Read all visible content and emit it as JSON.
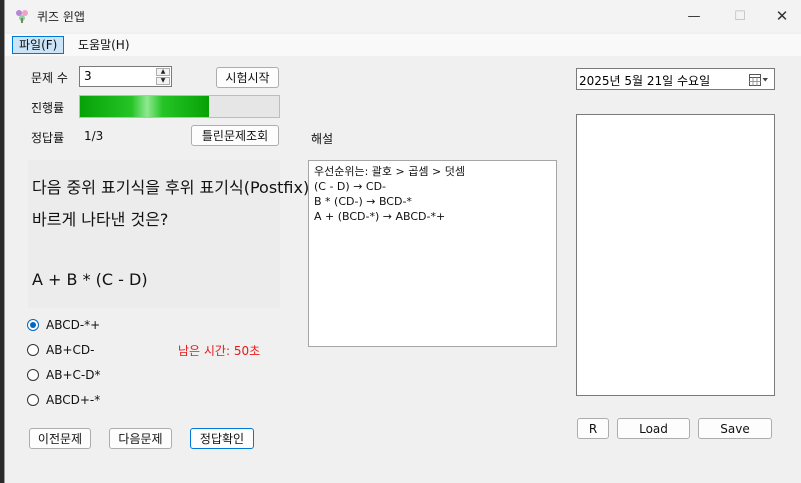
{
  "window": {
    "title": "퀴즈 윈앱",
    "controls": {
      "minimize": "—",
      "maximize": "☐",
      "close": "✕"
    }
  },
  "menu": [
    {
      "label": "파일(F)"
    },
    {
      "label": "도움말(H)"
    }
  ],
  "controls": {
    "question_count_label": "문제 수",
    "question_count_value": "3",
    "start_button": "시험시작",
    "progress_label": "진행률",
    "progress_value": 0.65,
    "accuracy_label": "정답률",
    "accuracy_value": "1/3",
    "wrong_review_button": "틀린문제조회"
  },
  "question": {
    "line1": "다음 중위 표기식을 후위 표기식(Postfix)으로",
    "line2": "바르게 나타낸 것은?",
    "expression": "A + B * (C - D)"
  },
  "options": [
    {
      "label": "ABCD-*+",
      "checked": true
    },
    {
      "label": "AB+CD-",
      "checked": false
    },
    {
      "label": "AB+C-D*",
      "checked": false
    },
    {
      "label": "ABCD+-*",
      "checked": false
    }
  ],
  "timer": "남은 시간: 50초",
  "nav": {
    "prev": "이전문제",
    "next": "다음문제",
    "check": "정답확인"
  },
  "explanation": {
    "label": "해설",
    "lines": [
      "우선순위는: 괄호 > 곱셈 > 덧셈",
      "(C - D) → CD-",
      "B * (CD-) → BCD-*",
      "A + (BCD-*) → ABCD-*+"
    ]
  },
  "date": {
    "text": "2025년   5월 21일 수요일",
    "dropdown_icon": "▾"
  },
  "right_buttons": {
    "r": "R",
    "load": "Load",
    "save": "Save"
  },
  "colors": {
    "progress": "#06a106",
    "timer": "#e31b1b",
    "accent": "#0078d7"
  }
}
